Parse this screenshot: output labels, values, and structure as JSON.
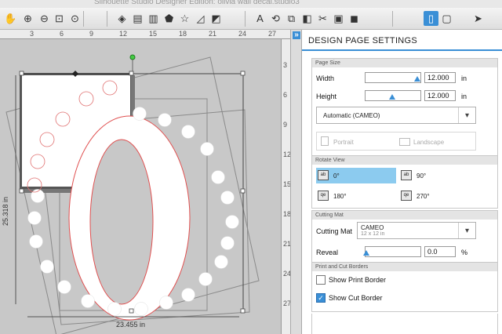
{
  "window": {
    "title": "Silhouette Studio Designer Edition: olivia wall decal.studio3"
  },
  "toolbar": {
    "tools": [
      "hand-icon",
      "zoom-in-icon",
      "zoom-out-icon",
      "zoom-fit-icon",
      "zoom-drag-icon",
      "fill-icon",
      "line-color-icon",
      "gradient-icon",
      "pentagon-icon",
      "star-icon",
      "shape-edit-icon",
      "offset-icon",
      "text-icon",
      "transform-icon",
      "replicate-icon",
      "trace-icon",
      "knife-icon",
      "library-icon",
      "store-icon",
      "page-settings-icon",
      "cut-settings-icon",
      "send-icon"
    ]
  },
  "rulers": {
    "top": [
      "3",
      "6",
      "9",
      "12",
      "15",
      "18",
      "21",
      "24",
      "27"
    ],
    "side": [
      "3",
      "6",
      "9",
      "12",
      "15",
      "18",
      "21",
      "24",
      "27"
    ]
  },
  "canvas": {
    "dim_width": "23.455 in",
    "dim_height": "25.318 in"
  },
  "panel": {
    "title": "DESIGN PAGE SETTINGS",
    "page_size": {
      "header": "Page Size",
      "width_label": "Width",
      "width_value": "12.000",
      "height_label": "Height",
      "height_value": "12.000",
      "unit": "in",
      "preset": "Automatic (CAMEO)",
      "portrait_label": "Portrait",
      "landscape_label": "Landscape"
    },
    "rotate_view": {
      "header": "Rotate View",
      "options": [
        "0°",
        "90°",
        "180°",
        "270°"
      ],
      "selected": "0°"
    },
    "cutting_mat": {
      "header": "Cutting Mat",
      "label": "Cutting Mat",
      "value": "CAMEO",
      "sub": "12 x 12 in",
      "reveal_label": "Reveal",
      "reveal_value": "0.0",
      "reveal_unit": "%"
    },
    "borders": {
      "header": "Print and Cut Borders",
      "print_label": "Show Print Border",
      "print_checked": false,
      "cut_label": "Show Cut Border",
      "cut_checked": true
    }
  },
  "colors": {
    "accent": "#3a8fd6",
    "selected_row": "#8ccbef",
    "cut_line": "#e05050"
  }
}
